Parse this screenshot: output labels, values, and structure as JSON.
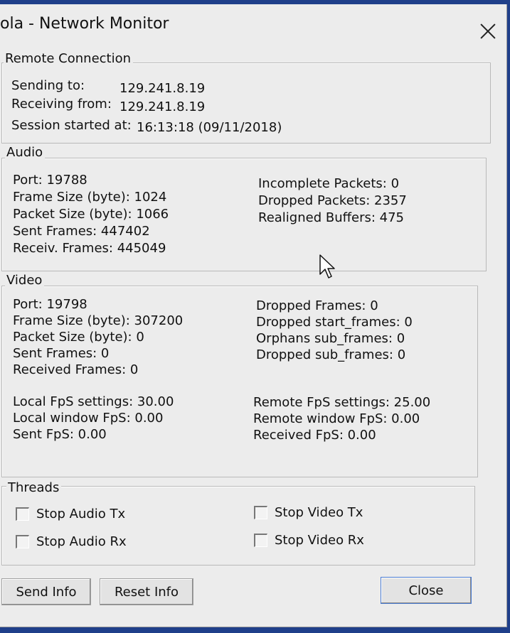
{
  "window": {
    "title": "ola - Network Monitor"
  },
  "remote": {
    "legend": "Remote Connection",
    "sending_label": "Sending to:",
    "sending_value": "129.241.8.19",
    "receiving_label": "Receiving from:",
    "receiving_value": "129.241.8.19",
    "session_label": "Session started at:",
    "session_value": "16:13:18 (09/11/2018)"
  },
  "audio": {
    "legend": "Audio",
    "left": [
      "Port: 19788",
      "Frame Size (byte): 1024",
      "Packet Size (byte): 1066",
      "Sent Frames: 447402",
      "Receiv. Frames: 445049"
    ],
    "right": [
      "Incomplete Packets: 0",
      "Dropped Packets: 2357",
      "Realigned Buffers: 475"
    ]
  },
  "video": {
    "legend": "Video",
    "left": [
      "Port: 19798",
      "Frame Size (byte): 307200",
      "Packet Size (byte): 0",
      "Sent Frames: 0",
      "Received Frames: 0"
    ],
    "right": [
      "Dropped Frames: 0",
      "Dropped start_frames: 0",
      "Orphans sub_frames: 0",
      "Dropped sub_frames: 0"
    ],
    "fps_left": [
      "Local FpS settings: 30.00",
      "Local window FpS: 0.00",
      "Sent FpS: 0.00"
    ],
    "fps_right": [
      "Remote FpS settings: 25.00",
      "Remote window FpS: 0.00",
      "Received FpS: 0.00"
    ]
  },
  "threads": {
    "legend": "Threads",
    "stop_audio_tx": "Stop Audio Tx",
    "stop_audio_rx": "Stop Audio Rx",
    "stop_video_tx": "Stop Video Tx",
    "stop_video_rx": "Stop Video Rx"
  },
  "buttons": {
    "send_info": "Send Info",
    "reset_info": "Reset Info",
    "close": "Close"
  }
}
